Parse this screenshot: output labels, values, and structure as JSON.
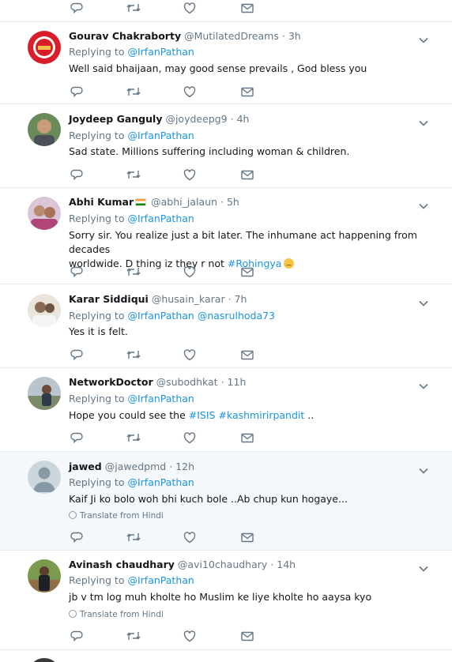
{
  "tweets": [
    {
      "name": "Gourav Chakraborty",
      "handle": "@MutilatedDreams",
      "time": "3h",
      "replying_label": "Replying to",
      "replying_to": [
        "@IrfanPathan"
      ],
      "text": "Well said bhaijaan, may good sense prevails , God bless you"
    },
    {
      "name": "Joydeep Ganguly",
      "handle": "@joydeepg9",
      "time": "4h",
      "replying_label": "Replying to",
      "replying_to": [
        "@IrfanPathan"
      ],
      "text": "Sad state. Millions suffering including woman & children."
    },
    {
      "name": "Abhi Kumar",
      "handle": "@abhi_jalaun",
      "time": "5h",
      "replying_label": "Replying to",
      "replying_to": [
        "@IrfanPathan"
      ],
      "text_line1": "Sorry sir. You realize just a bit later. The inhumane act happening from decades",
      "text_line2": "worldwide. D thing iz they r not ",
      "hashtag": "#Rohingya"
    },
    {
      "name": "Karar Siddiqui",
      "handle": "@husain_karar",
      "time": "7h",
      "replying_label": "Replying to",
      "replying_to": [
        "@IrfanPathan",
        "@nasrulhoda73"
      ],
      "text": "Yes it is felt."
    },
    {
      "name": "NetworkDoctor",
      "handle": "@subodhkat",
      "time": "11h",
      "replying_label": "Replying to",
      "replying_to": [
        "@IrfanPathan"
      ],
      "text_prefix": "Hope you could see the ",
      "hashtag1": "#ISIS",
      "hashtag2": "#kashmirirpandit",
      "text_suffix": " .."
    },
    {
      "name": "jawed",
      "handle": "@jawedpmd",
      "time": "12h",
      "replying_label": "Replying to",
      "replying_to": [
        "@IrfanPathan"
      ],
      "text": "Kaif Ji ko bolo woh bhi kuch bole ..Ab chup kun hogaye...",
      "translate": "Translate from Hindi"
    },
    {
      "name": "Avinash chaudhary",
      "handle": "@avi10chaudhary",
      "time": "14h",
      "replying_label": "Replying to",
      "replying_to": [
        "@IrfanPathan"
      ],
      "text": "jb v tm log muh kholte ho Muslim ke liye kholte ho aaysa kyo",
      "translate": "Translate from Hindi"
    }
  ],
  "colors": {
    "link": "#1b95e0",
    "muted": "#657786",
    "shaded_row": "#f5f8fa",
    "divider": "#e6ecf0"
  },
  "icons": [
    "reply-icon",
    "retweet-icon",
    "like-icon",
    "direct-message-icon",
    "caret-down-icon",
    "globe-icon"
  ]
}
